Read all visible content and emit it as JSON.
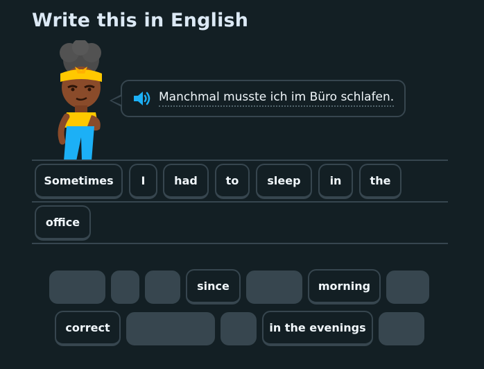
{
  "header": {
    "title": "Write this in English"
  },
  "prompt": {
    "sentence": "Manchmal musste ich im Büro schlafen.",
    "speaker_icon": "speaker-icon"
  },
  "answer": {
    "tiles": [
      "Sometimes",
      "I",
      "had",
      "to",
      "sleep",
      "in",
      "the",
      "office"
    ]
  },
  "word_bank": {
    "row1": [
      "since",
      "morning"
    ],
    "row2": [
      "correct",
      "in the evenings"
    ]
  },
  "colors": {
    "background": "#131f24",
    "border": "#37464f",
    "title": "#dce9f5",
    "text": "#f1f7fb",
    "speaker": "#1cb0f6",
    "character_hair": "#4b4b4b",
    "character_bandana": "#ffc800",
    "character_pants": "#1cb0f6"
  }
}
